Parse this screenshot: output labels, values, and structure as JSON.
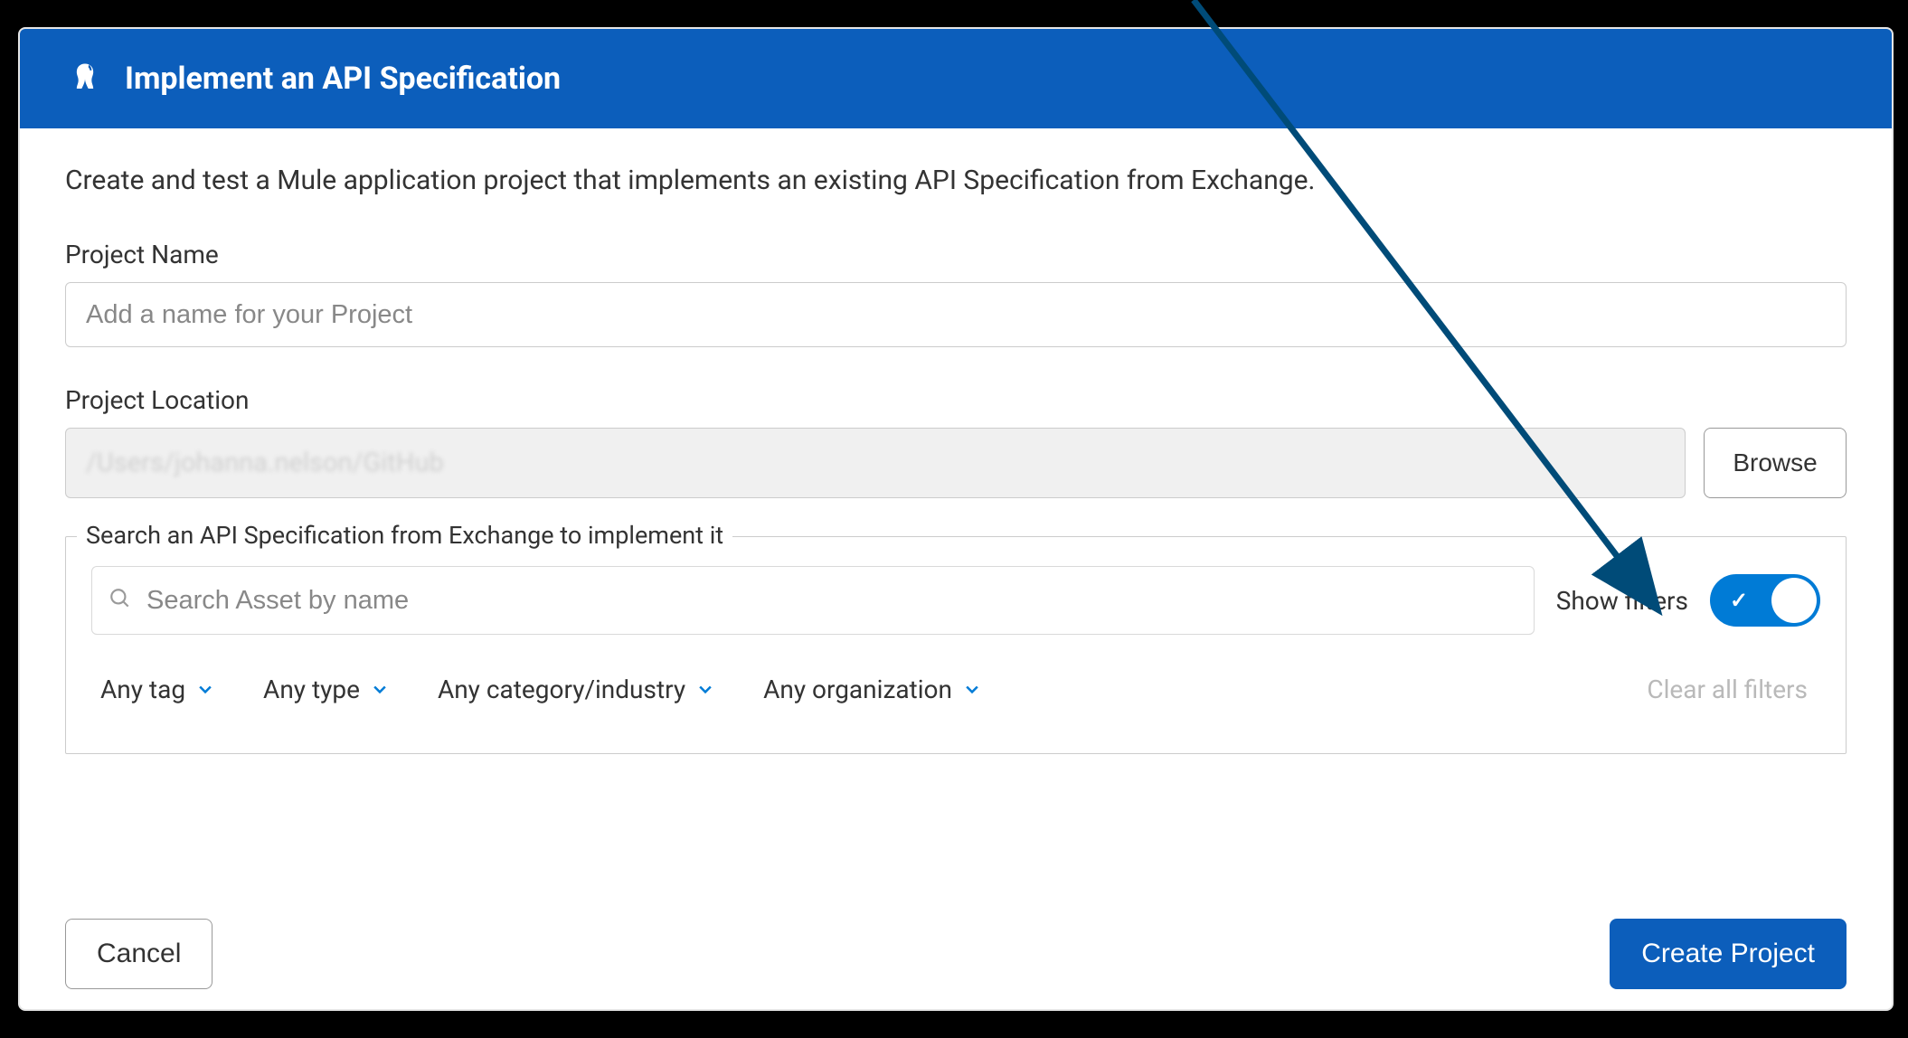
{
  "header": {
    "title": "Implement an API Specification"
  },
  "description": "Create and test a Mule application project that implements an existing API Specification from Exchange.",
  "project_name": {
    "label": "Project Name",
    "placeholder": "Add a name for your Project",
    "value": ""
  },
  "project_location": {
    "label": "Project Location",
    "value": "/Users/johanna.nelson/GitHub",
    "browse_label": "Browse"
  },
  "search": {
    "legend": "Search an API Specification from Exchange to implement it",
    "placeholder": "Search Asset by name",
    "show_filters_label": "Show filters",
    "show_filters_on": true,
    "filters": [
      "Any tag",
      "Any type",
      "Any category/industry",
      "Any organization"
    ],
    "clear_label": "Clear all filters"
  },
  "footer": {
    "cancel": "Cancel",
    "create": "Create Project"
  },
  "colors": {
    "header_blue": "#0c5ebb",
    "accent_blue": "#007bd6"
  }
}
